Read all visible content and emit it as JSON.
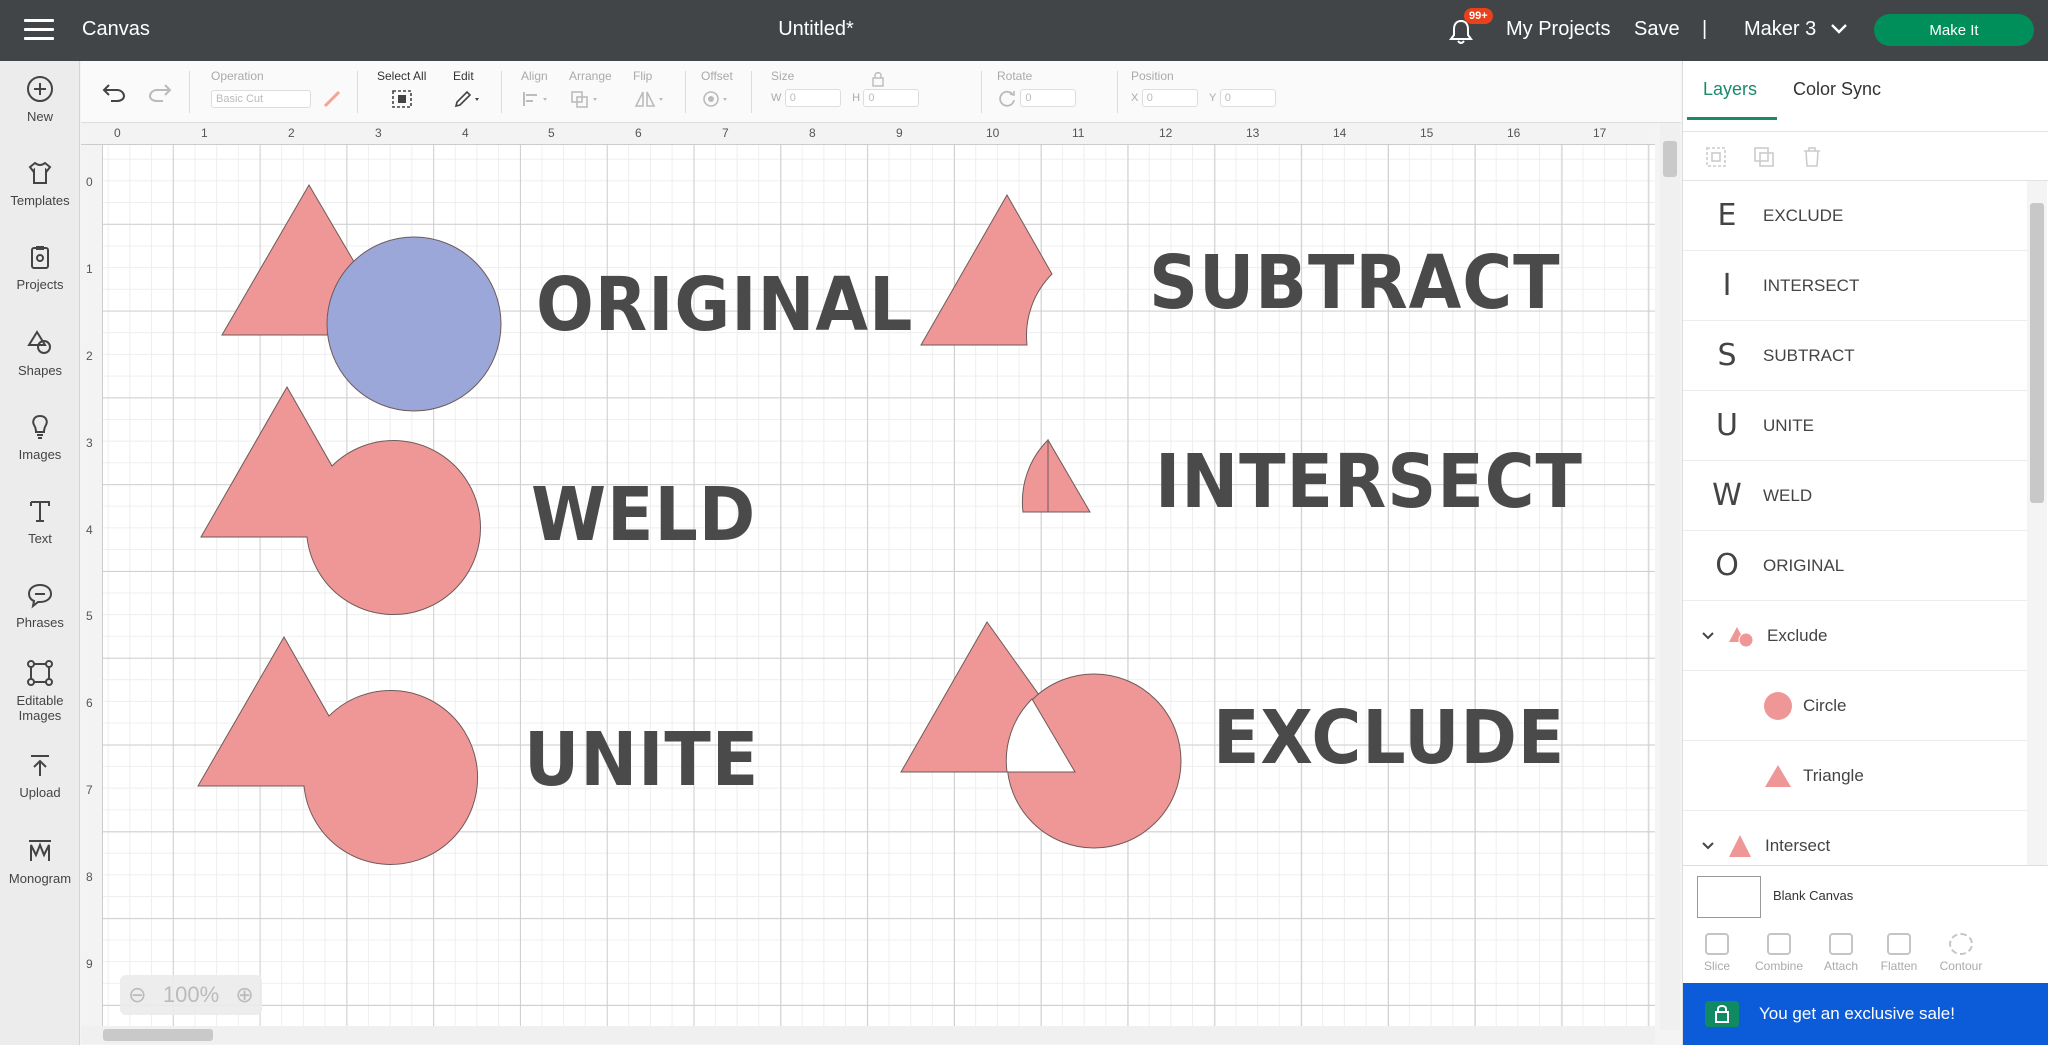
{
  "topbar": {
    "app_name": "Canvas",
    "doc_title": "Untitled*",
    "notif_badge": "99+",
    "my_projects": "My Projects",
    "save": "Save",
    "divider": "|",
    "machine": "Maker 3",
    "make_it": "Make It"
  },
  "sidebar": {
    "items": [
      {
        "label": "New",
        "icon": "plus-circle-icon"
      },
      {
        "label": "Templates",
        "icon": "shirt-icon"
      },
      {
        "label": "Projects",
        "icon": "clipboard-icon"
      },
      {
        "label": "Shapes",
        "icon": "shapes-icon"
      },
      {
        "label": "Images",
        "icon": "lightbulb-icon"
      },
      {
        "label": "Text",
        "icon": "text-icon"
      },
      {
        "label": "Phrases",
        "icon": "speech-bubble-icon"
      },
      {
        "label": "Editable",
        "label2": "Images",
        "icon": "editable-images-icon"
      },
      {
        "label": "Upload",
        "icon": "upload-icon"
      },
      {
        "label": "Monogram",
        "icon": "monogram-icon"
      }
    ]
  },
  "toolbar": {
    "operation_label": "Operation",
    "operation_value": "Basic Cut",
    "select_all": "Select All",
    "edit": "Edit",
    "align": "Align",
    "arrange": "Arrange",
    "flip": "Flip",
    "offset": "Offset",
    "size": "Size",
    "w": "W",
    "h": "H",
    "w_value": "0",
    "h_value": "0",
    "rotate": "Rotate",
    "rotate_value": "0",
    "position": "Position",
    "x": "X",
    "y": "Y",
    "x_value": "0",
    "y_value": "0"
  },
  "canvas": {
    "ruler_top": [
      "0",
      "1",
      "2",
      "3",
      "4",
      "5",
      "6",
      "7",
      "8",
      "9",
      "10",
      "11",
      "12",
      "13",
      "14",
      "15",
      "16",
      "17"
    ],
    "ruler_left": [
      "0",
      "1",
      "2",
      "3",
      "4",
      "5",
      "6",
      "7",
      "8",
      "9"
    ],
    "labels": {
      "original": "ORIGINAL",
      "weld": "WELD",
      "unite": "UNITE",
      "subtract": "SUBTRACT",
      "intersect": "INTERSECT",
      "exclude": "EXCLUDE"
    },
    "zoom": "100%",
    "colors": {
      "shape_fill": "#ef9797",
      "circle_original": "#9ba7d9",
      "stroke": "#6f5a5a",
      "text": "#4a4a4a"
    }
  },
  "panel": {
    "tabs": [
      "Layers",
      "Color Sync"
    ],
    "layers": [
      {
        "glyph": "E",
        "name": "EXCLUDE"
      },
      {
        "glyph": "I",
        "name": "INTERSECT"
      },
      {
        "glyph": "S",
        "name": "SUBTRACT"
      },
      {
        "glyph": "U",
        "name": "UNITE"
      },
      {
        "glyph": "W",
        "name": "WELD"
      },
      {
        "glyph": "O",
        "name": "ORIGINAL"
      }
    ],
    "group_exclude": "Exclude",
    "child_circle": "Circle",
    "child_triangle": "Triangle",
    "group_intersect": "Intersect",
    "blank_canvas": "Blank Canvas",
    "bottom_tools": [
      "Slice",
      "Combine",
      "Attach",
      "Flatten",
      "Contour"
    ],
    "sale": "You get an exclusive sale!"
  }
}
